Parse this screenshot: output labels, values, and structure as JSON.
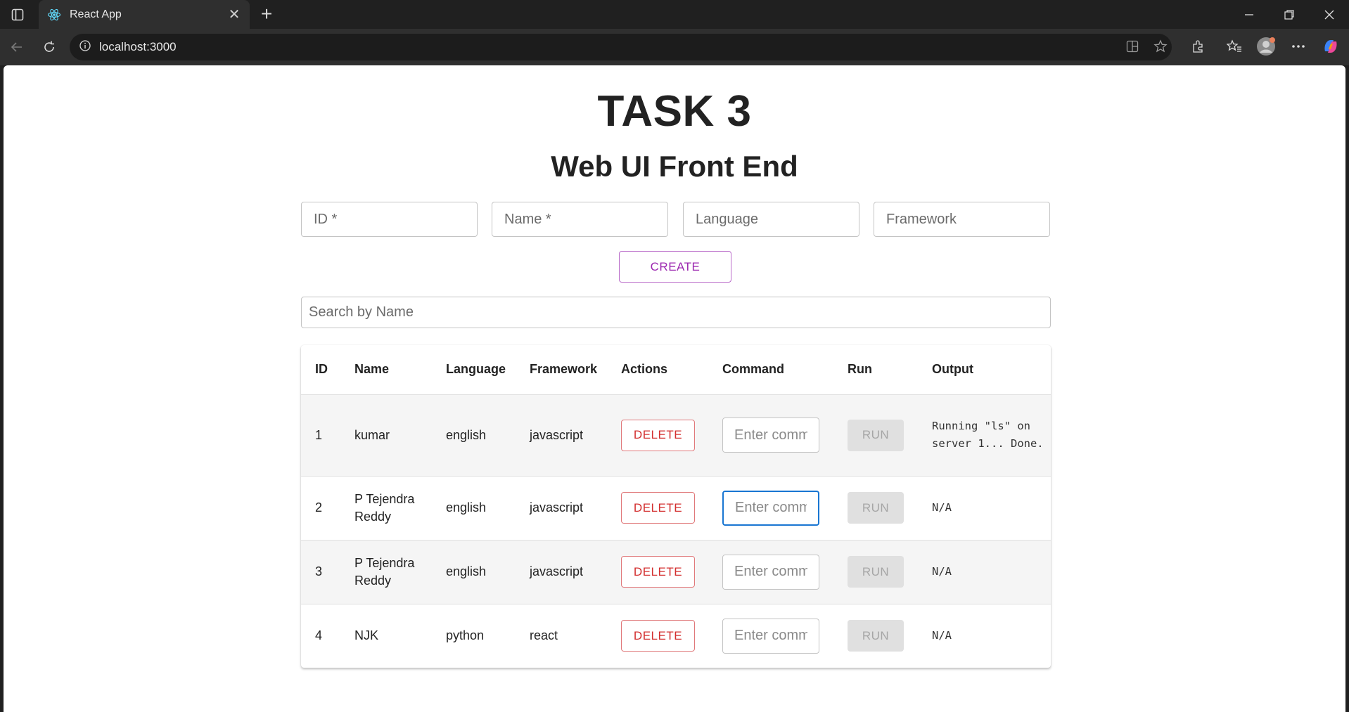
{
  "browser": {
    "tab_title": "React App",
    "url": "localhost:3000"
  },
  "page": {
    "title": "TASK 3",
    "subtitle": "Web UI Front End",
    "form": {
      "id_placeholder": "ID *",
      "name_placeholder": "Name *",
      "language_placeholder": "Language",
      "framework_placeholder": "Framework",
      "create_label": "CREATE"
    },
    "search_placeholder": "Search by Name",
    "table": {
      "headers": [
        "ID",
        "Name",
        "Language",
        "Framework",
        "Actions",
        "Command",
        "Run",
        "Output"
      ],
      "rows": [
        {
          "id": "1",
          "name": "kumar",
          "language": "english",
          "framework": "javascript",
          "delete_label": "DELETE",
          "command_placeholder": "Enter comm",
          "run_label": "RUN",
          "output": "Running \"ls\" on server 1... Done."
        },
        {
          "id": "2",
          "name": "P Tejendra Reddy",
          "language": "english",
          "framework": "javascript",
          "delete_label": "DELETE",
          "command_placeholder": "Enter comm",
          "run_label": "RUN",
          "output": "N/A"
        },
        {
          "id": "3",
          "name": "P Tejendra Reddy",
          "language": "english",
          "framework": "javascript",
          "delete_label": "DELETE",
          "command_placeholder": "Enter comm",
          "run_label": "RUN",
          "output": "N/A"
        },
        {
          "id": "4",
          "name": "NJK",
          "language": "python",
          "framework": "react",
          "delete_label": "DELETE",
          "command_placeholder": "Enter comm",
          "run_label": "RUN",
          "output": "N/A"
        }
      ]
    }
  },
  "colors": {
    "create_accent": "#9c27b0",
    "delete_accent": "#d32f2f",
    "focus_accent": "#1976d2"
  }
}
